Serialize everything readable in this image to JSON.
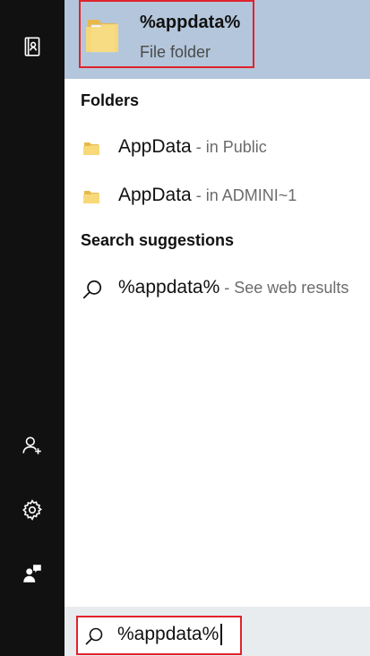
{
  "best_match": {
    "title": "%appdata%",
    "subtitle": "File folder"
  },
  "folders": {
    "heading": "Folders",
    "items": [
      {
        "name": "AppData",
        "location": " - in Public"
      },
      {
        "name": "AppData",
        "location": " - in ADMINI~1"
      }
    ]
  },
  "suggestions": {
    "heading": "Search suggestions",
    "items": [
      {
        "query": "%appdata%",
        "hint": " - See web results"
      }
    ]
  },
  "search": {
    "value": "%appdata%"
  },
  "rail": {
    "icons": [
      "notebook-icon",
      "person-add-icon",
      "gear-icon",
      "feedback-icon"
    ]
  },
  "colors": {
    "rail_bg": "#111111",
    "best_match_bg": "#b3c6db",
    "highlight_border": "#e0232c",
    "folder_yellow": "#f5d36b"
  }
}
